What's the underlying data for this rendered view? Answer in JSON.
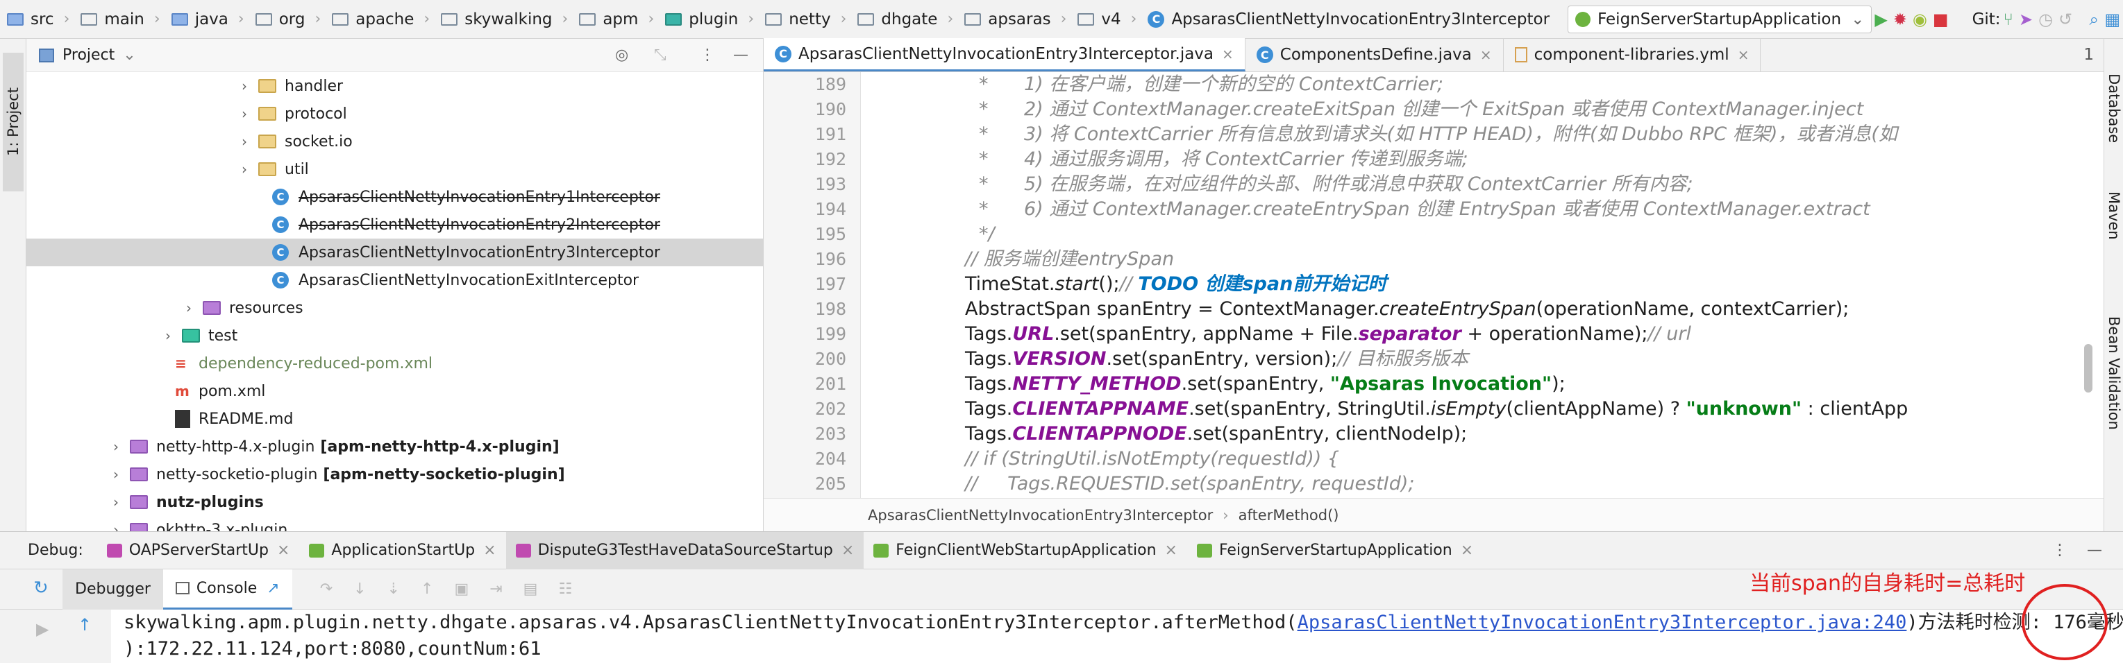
{
  "breadcrumbs": [
    "src",
    "main",
    "java",
    "org",
    "apache",
    "skywalking",
    "apm",
    "plugin",
    "netty",
    "dhgate",
    "apsaras",
    "v4",
    "ApsarasClientNettyInvocationEntry3Interceptor"
  ],
  "run_config": "FeignServerStartupApplication",
  "git_label": "Git:",
  "left_stripe": {
    "project_tab": "1: Project"
  },
  "right_stripe": {
    "database": "Database",
    "maven": "Maven",
    "bean": "Bean Validation"
  },
  "project": {
    "title": "Project",
    "items": [
      {
        "label": "handler",
        "type": "folder",
        "indent": 1
      },
      {
        "label": "protocol",
        "type": "folder",
        "indent": 1
      },
      {
        "label": "socket.io",
        "type": "folder",
        "indent": 1
      },
      {
        "label": "util",
        "type": "folder",
        "indent": 1
      },
      {
        "label": "ApsarasClientNettyInvocationEntry1Interceptor",
        "type": "class",
        "strike": true
      },
      {
        "label": "ApsarasClientNettyInvocationEntry2Interceptor",
        "type": "class",
        "strike": true
      },
      {
        "label": "ApsarasClientNettyInvocationEntry3Interceptor",
        "type": "class",
        "selected": true
      },
      {
        "label": "ApsarasClientNettyInvocationExitInterceptor",
        "type": "class"
      },
      {
        "label": "resources",
        "type": "resources"
      },
      {
        "label": "test",
        "type": "test"
      },
      {
        "label": "dependency-reduced-pom.xml",
        "type": "xml"
      },
      {
        "label": "pom.xml",
        "type": "maven"
      },
      {
        "label": "README.md",
        "type": "md"
      },
      {
        "label": "netty-http-4.x-plugin",
        "extra": "[apm-netty-http-4.x-plugin]",
        "type": "module"
      },
      {
        "label": "netty-socketio-plugin",
        "extra": "[apm-netty-socketio-plugin]",
        "type": "module"
      },
      {
        "label": "nutz-plugins",
        "type": "module"
      },
      {
        "label": "okhttp-3.x-plugin",
        "type": "module"
      }
    ]
  },
  "editor": {
    "tabs": [
      {
        "label": "ApsarasClientNettyInvocationEntry3Interceptor.java",
        "active": true
      },
      {
        "label": "ComponentsDefine.java"
      },
      {
        "label": "component-libraries.yml"
      }
    ],
    "tab_overflow": "1",
    "line_numbers": [
      "189",
      "190",
      "191",
      "192",
      "193",
      "194",
      "195",
      "196",
      "197",
      "198",
      "199",
      "200",
      "201",
      "202",
      "203",
      "204",
      "205"
    ],
    "breadcrumb": [
      "ApsarasClientNettyInvocationEntry3Interceptor",
      "afterMethod()"
    ]
  },
  "debug": {
    "label": "Debug:",
    "tabs": [
      "OAPServerStartUp",
      "ApplicationStartUp",
      "DisputeG3TestHaveDataSourceStartup",
      "FeignClientWebStartupApplication",
      "FeignServerStartupApplication"
    ],
    "subtabs": [
      "Debugger",
      "Console"
    ],
    "console_line1_prefix": "skywalking.apm.plugin.netty.dhgate.apsaras.v4.ApsarasClientNettyInvocationEntry3Interceptor.afterMethod(",
    "console_link": "ApsarasClientNettyInvocationEntry3Interceptor.java:240",
    "console_line1_suffix": ")方法耗时检测: 176毫秒",
    "console_line2": "):172.22.11.124,port:8080,countNum:61",
    "annotation": "当前span的自身耗时=总耗时"
  }
}
